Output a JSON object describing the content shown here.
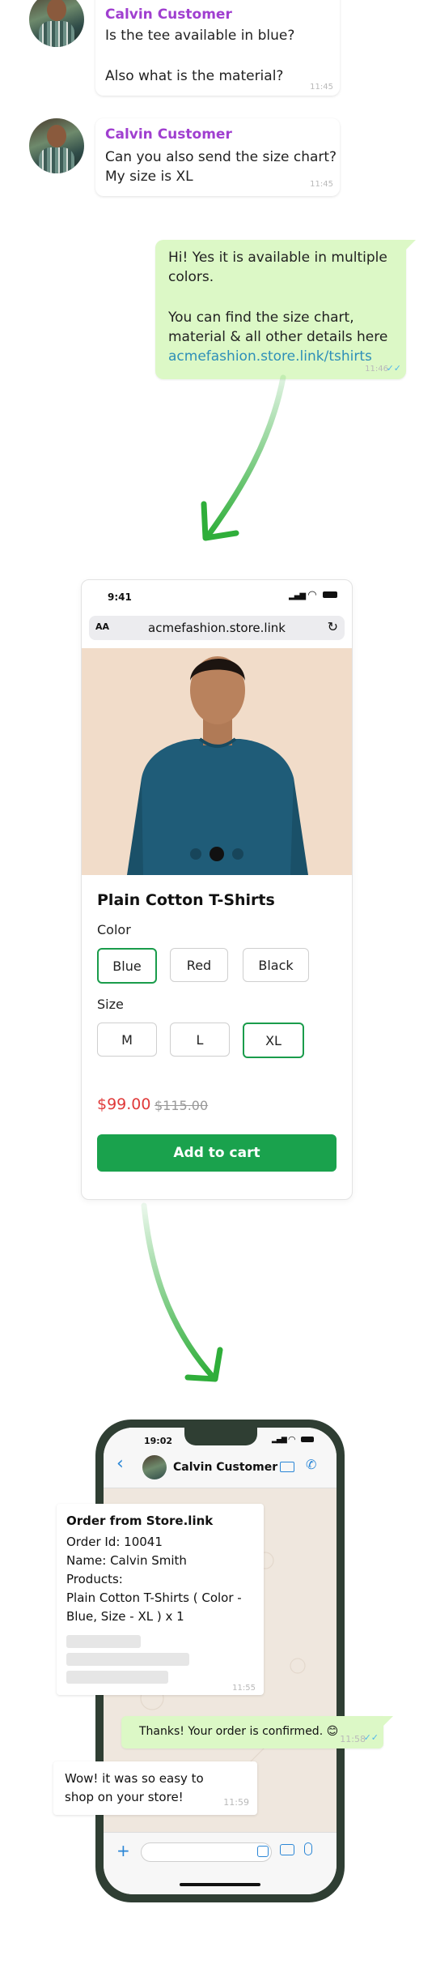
{
  "chat_top": {
    "messages": [
      {
        "sender": "Calvin Customer",
        "lines": [
          "Is the tee available in blue?",
          "",
          "Also what is the material?"
        ],
        "time": "11:45"
      },
      {
        "sender": "Calvin Customer",
        "lines": [
          "Can you also send the size chart?",
          "My size is XL"
        ],
        "time": "11:45"
      }
    ],
    "reply": {
      "lines": [
        "Hi! Yes it is available in multiple",
        "colors.",
        "",
        "You can find the size chart,",
        "material & all other details here"
      ],
      "link": "acmefashion.store.link/tshirts",
      "time": "11:46"
    }
  },
  "browser": {
    "status_time": "9:41",
    "aa_label": "AA",
    "url": "acmefashion.store.link",
    "product_title": "Plain Cotton T-Shirts",
    "color_label": "Color",
    "colors": [
      "Blue",
      "Red",
      "Black"
    ],
    "selected_color": "Blue",
    "size_label": "Size",
    "sizes": [
      "M",
      "L",
      "XL"
    ],
    "selected_size": "XL",
    "price": "$99.00",
    "old_price": "$115.00",
    "add_to_cart": "Add to cart",
    "carousel_dots": 3,
    "carousel_active": 1
  },
  "phone": {
    "status_time": "19:02",
    "contact_name": "Calvin Customer",
    "order_message": {
      "title": "Order from Store.link",
      "lines": [
        "Order Id: 10041",
        "Name: Calvin Smith",
        "Products:",
        "Plain Cotton T-Shirts ( Color -",
        "Blue, Size - XL ) x 1"
      ],
      "time": "11:55"
    },
    "confirm_message": {
      "text": "Thanks! Your order is confirmed. 😊",
      "time": "11:58"
    },
    "customer_message": {
      "lines": [
        "Wow! it was so easy to",
        "shop on your store!"
      ],
      "time": "11:59"
    }
  },
  "colors": {
    "sender": "#a03fd0",
    "out_bubble": "#dcf8c6",
    "accent_green": "#1aa24d",
    "price_red": "#e03a3a",
    "link": "#2e8fb8",
    "arrow": "#2fae3a"
  }
}
